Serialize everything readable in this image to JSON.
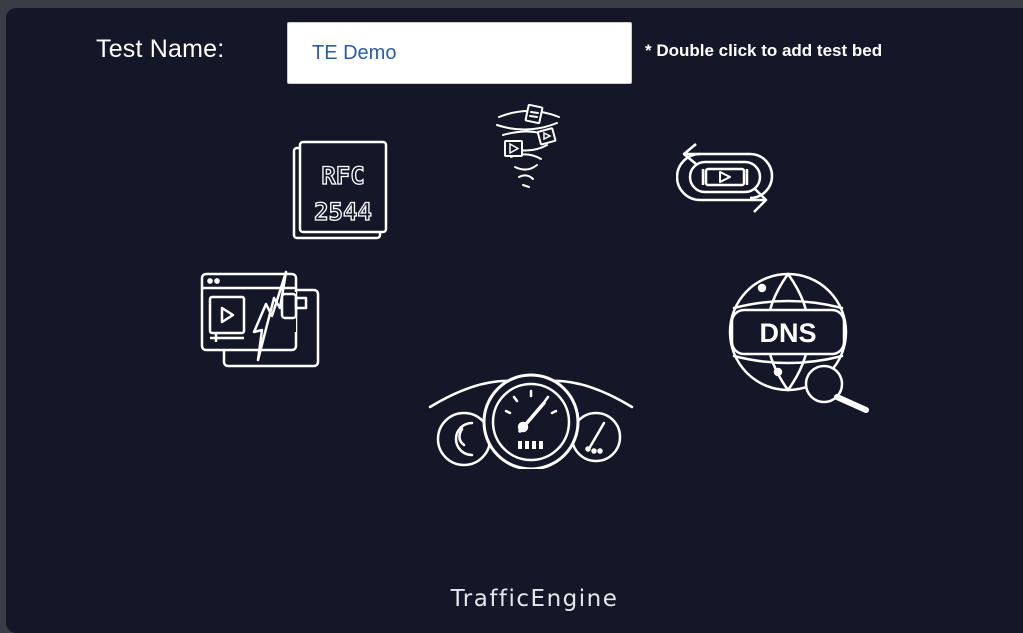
{
  "form": {
    "test_name_label": "Test Name:",
    "test_name_value": "TE Demo",
    "hint": "* Double click to add test bed"
  },
  "icons": {
    "rfc": {
      "line1": "RFC",
      "line2": "2544"
    },
    "dns": {
      "label": "DNS"
    }
  },
  "brand": {
    "label": "TrafficEngine"
  },
  "colors": {
    "background": "#141728",
    "icon_stroke": "#ffffff",
    "input_text": "#2a5caa"
  }
}
